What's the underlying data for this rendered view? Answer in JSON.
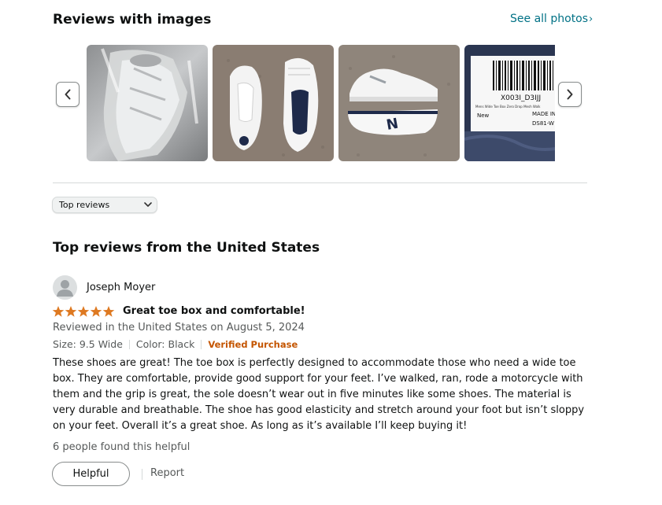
{
  "images_section": {
    "title": "Reviews with images",
    "see_all_label": "See all photos",
    "see_all_chevron": "›",
    "thumbnails": [
      {
        "subject": "shoe in plastic bag"
      },
      {
        "subject": "pair of white shoes top view"
      },
      {
        "subject": "white shoes side view"
      },
      {
        "subject": "shipping label barcode"
      }
    ],
    "label_barcode_text": "X003I_D3IJJ",
    "label_small_text": "Mens Wide Toe Box Zero Drop Mesh Walk",
    "label_made_in": "MADE IN C",
    "label_new": "New",
    "label_code": "DS81-W"
  },
  "sort": {
    "selected": "Top reviews"
  },
  "reviews_section": {
    "title": "Top reviews from the United States"
  },
  "review": {
    "reviewer": "Joseph Moyer",
    "rating": 5,
    "star_color": "#de7921",
    "title": "Great toe box and comfortable!",
    "date": "Reviewed in the United States on August 5, 2024",
    "size": "Size: 9.5 Wide",
    "color": "Color: Black",
    "verified": "Verified Purchase",
    "body": "These shoes are great! The toe box is perfectly designed to accommodate those who need a wide toe box. They are comfortable, provide good support for your feet. I’ve walked, ran, rode a motorcycle with them and the grip is great, the sole doesn’t wear out in five minutes like some shoes. The material is very durable and breathable. The shoe has good elasticity and stretch around your foot but isn’t sloppy on your feet. Overall it’s a great shoe. As long as it’s available I’ll keep buying it!",
    "helpful_count": "6 people found this helpful",
    "helpful_button": "Helpful",
    "report_label": "Report"
  },
  "colors": {
    "link": "#007185",
    "verified": "#c45500",
    "star": "#de7921",
    "border": "#d5d9d9"
  }
}
